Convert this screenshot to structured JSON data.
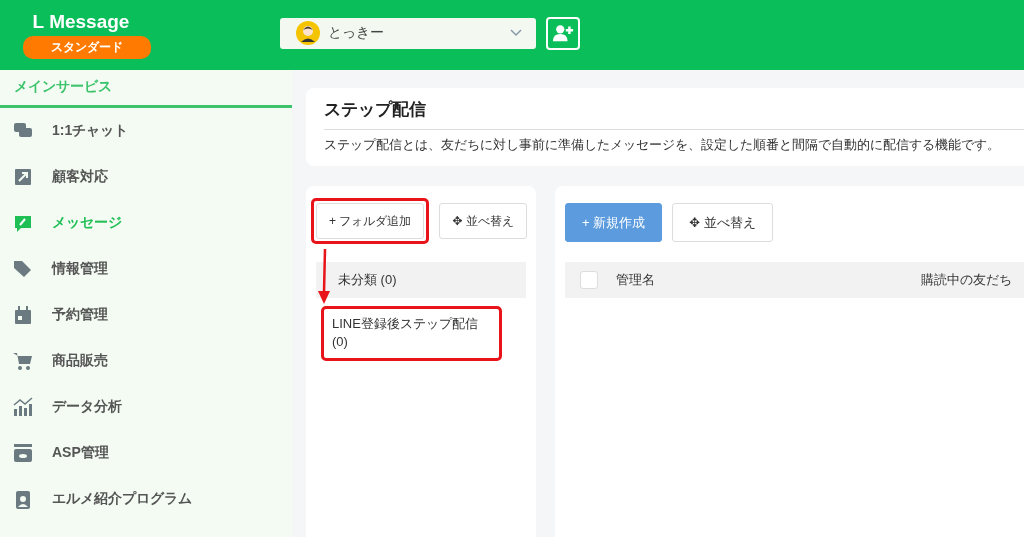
{
  "header": {
    "logo": "L Message",
    "plan_badge": "スタンダード",
    "account": {
      "name": "とっきー"
    }
  },
  "sidebar": {
    "section_title": "メインサービス",
    "items": [
      {
        "label": "1:1チャット",
        "selected": false
      },
      {
        "label": "顧客対応",
        "selected": false
      },
      {
        "label": "メッセージ",
        "selected": true
      },
      {
        "label": "情報管理",
        "selected": false
      },
      {
        "label": "予約管理",
        "selected": false
      },
      {
        "label": "商品販売",
        "selected": false
      },
      {
        "label": "データ分析",
        "selected": false
      },
      {
        "label": "ASP管理",
        "selected": false
      },
      {
        "label": "エルメ紹介プログラム",
        "selected": false
      }
    ]
  },
  "page": {
    "title": "ステップ配信",
    "description": "ステップ配信とは、友だちに対し事前に準備したメッセージを、設定した順番と間隔で自動的に配信する機能です。"
  },
  "folder_panel": {
    "buttons": [
      {
        "label": "+ フォルダ追加",
        "highlighted": true
      },
      {
        "label": "✥ 並べ替え",
        "highlighted": false
      }
    ],
    "folders": [
      {
        "label": "未分類 (0)",
        "selected": true,
        "highlighted": false
      },
      {
        "label": "LINE登録後ステップ配信 (0)",
        "selected": false,
        "highlighted": true
      }
    ]
  },
  "list_panel": {
    "buttons": [
      {
        "label": "+ 新規作成",
        "kind": "primary"
      },
      {
        "label": "✥ 並べ替え",
        "kind": "default"
      }
    ],
    "table": {
      "select_all_checked": false,
      "columns": [
        "管理名",
        "購読中の友だち"
      ]
    }
  }
}
